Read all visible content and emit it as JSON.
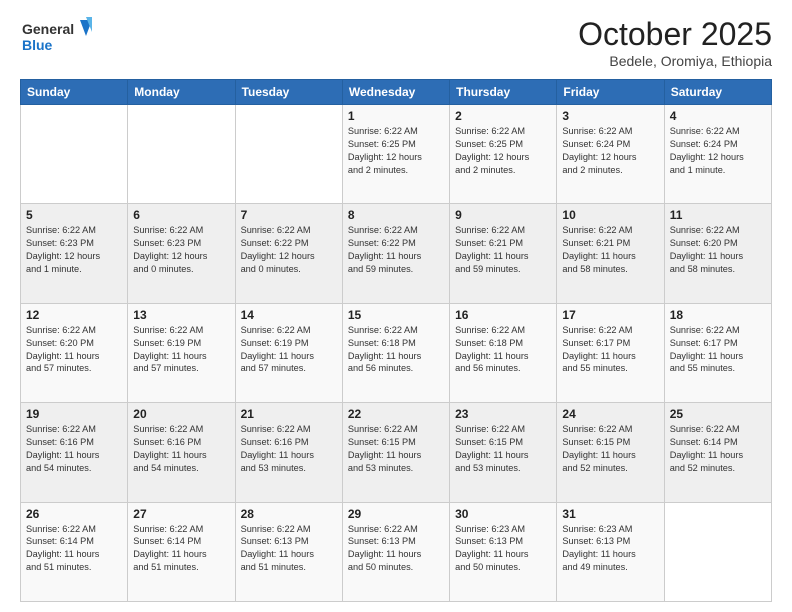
{
  "header": {
    "logo_general": "General",
    "logo_blue": "Blue",
    "month_title": "October 2025",
    "subtitle": "Bedele, Oromiya, Ethiopia"
  },
  "weekdays": [
    "Sunday",
    "Monday",
    "Tuesday",
    "Wednesday",
    "Thursday",
    "Friday",
    "Saturday"
  ],
  "weeks": [
    [
      {
        "day": "",
        "info": ""
      },
      {
        "day": "",
        "info": ""
      },
      {
        "day": "",
        "info": ""
      },
      {
        "day": "1",
        "info": "Sunrise: 6:22 AM\nSunset: 6:25 PM\nDaylight: 12 hours\nand 2 minutes."
      },
      {
        "day": "2",
        "info": "Sunrise: 6:22 AM\nSunset: 6:25 PM\nDaylight: 12 hours\nand 2 minutes."
      },
      {
        "day": "3",
        "info": "Sunrise: 6:22 AM\nSunset: 6:24 PM\nDaylight: 12 hours\nand 2 minutes."
      },
      {
        "day": "4",
        "info": "Sunrise: 6:22 AM\nSunset: 6:24 PM\nDaylight: 12 hours\nand 1 minute."
      }
    ],
    [
      {
        "day": "5",
        "info": "Sunrise: 6:22 AM\nSunset: 6:23 PM\nDaylight: 12 hours\nand 1 minute."
      },
      {
        "day": "6",
        "info": "Sunrise: 6:22 AM\nSunset: 6:23 PM\nDaylight: 12 hours\nand 0 minutes."
      },
      {
        "day": "7",
        "info": "Sunrise: 6:22 AM\nSunset: 6:22 PM\nDaylight: 12 hours\nand 0 minutes."
      },
      {
        "day": "8",
        "info": "Sunrise: 6:22 AM\nSunset: 6:22 PM\nDaylight: 11 hours\nand 59 minutes."
      },
      {
        "day": "9",
        "info": "Sunrise: 6:22 AM\nSunset: 6:21 PM\nDaylight: 11 hours\nand 59 minutes."
      },
      {
        "day": "10",
        "info": "Sunrise: 6:22 AM\nSunset: 6:21 PM\nDaylight: 11 hours\nand 58 minutes."
      },
      {
        "day": "11",
        "info": "Sunrise: 6:22 AM\nSunset: 6:20 PM\nDaylight: 11 hours\nand 58 minutes."
      }
    ],
    [
      {
        "day": "12",
        "info": "Sunrise: 6:22 AM\nSunset: 6:20 PM\nDaylight: 11 hours\nand 57 minutes."
      },
      {
        "day": "13",
        "info": "Sunrise: 6:22 AM\nSunset: 6:19 PM\nDaylight: 11 hours\nand 57 minutes."
      },
      {
        "day": "14",
        "info": "Sunrise: 6:22 AM\nSunset: 6:19 PM\nDaylight: 11 hours\nand 57 minutes."
      },
      {
        "day": "15",
        "info": "Sunrise: 6:22 AM\nSunset: 6:18 PM\nDaylight: 11 hours\nand 56 minutes."
      },
      {
        "day": "16",
        "info": "Sunrise: 6:22 AM\nSunset: 6:18 PM\nDaylight: 11 hours\nand 56 minutes."
      },
      {
        "day": "17",
        "info": "Sunrise: 6:22 AM\nSunset: 6:17 PM\nDaylight: 11 hours\nand 55 minutes."
      },
      {
        "day": "18",
        "info": "Sunrise: 6:22 AM\nSunset: 6:17 PM\nDaylight: 11 hours\nand 55 minutes."
      }
    ],
    [
      {
        "day": "19",
        "info": "Sunrise: 6:22 AM\nSunset: 6:16 PM\nDaylight: 11 hours\nand 54 minutes."
      },
      {
        "day": "20",
        "info": "Sunrise: 6:22 AM\nSunset: 6:16 PM\nDaylight: 11 hours\nand 54 minutes."
      },
      {
        "day": "21",
        "info": "Sunrise: 6:22 AM\nSunset: 6:16 PM\nDaylight: 11 hours\nand 53 minutes."
      },
      {
        "day": "22",
        "info": "Sunrise: 6:22 AM\nSunset: 6:15 PM\nDaylight: 11 hours\nand 53 minutes."
      },
      {
        "day": "23",
        "info": "Sunrise: 6:22 AM\nSunset: 6:15 PM\nDaylight: 11 hours\nand 53 minutes."
      },
      {
        "day": "24",
        "info": "Sunrise: 6:22 AM\nSunset: 6:15 PM\nDaylight: 11 hours\nand 52 minutes."
      },
      {
        "day": "25",
        "info": "Sunrise: 6:22 AM\nSunset: 6:14 PM\nDaylight: 11 hours\nand 52 minutes."
      }
    ],
    [
      {
        "day": "26",
        "info": "Sunrise: 6:22 AM\nSunset: 6:14 PM\nDaylight: 11 hours\nand 51 minutes."
      },
      {
        "day": "27",
        "info": "Sunrise: 6:22 AM\nSunset: 6:14 PM\nDaylight: 11 hours\nand 51 minutes."
      },
      {
        "day": "28",
        "info": "Sunrise: 6:22 AM\nSunset: 6:13 PM\nDaylight: 11 hours\nand 51 minutes."
      },
      {
        "day": "29",
        "info": "Sunrise: 6:22 AM\nSunset: 6:13 PM\nDaylight: 11 hours\nand 50 minutes."
      },
      {
        "day": "30",
        "info": "Sunrise: 6:23 AM\nSunset: 6:13 PM\nDaylight: 11 hours\nand 50 minutes."
      },
      {
        "day": "31",
        "info": "Sunrise: 6:23 AM\nSunset: 6:13 PM\nDaylight: 11 hours\nand 49 minutes."
      },
      {
        "day": "",
        "info": ""
      }
    ]
  ]
}
